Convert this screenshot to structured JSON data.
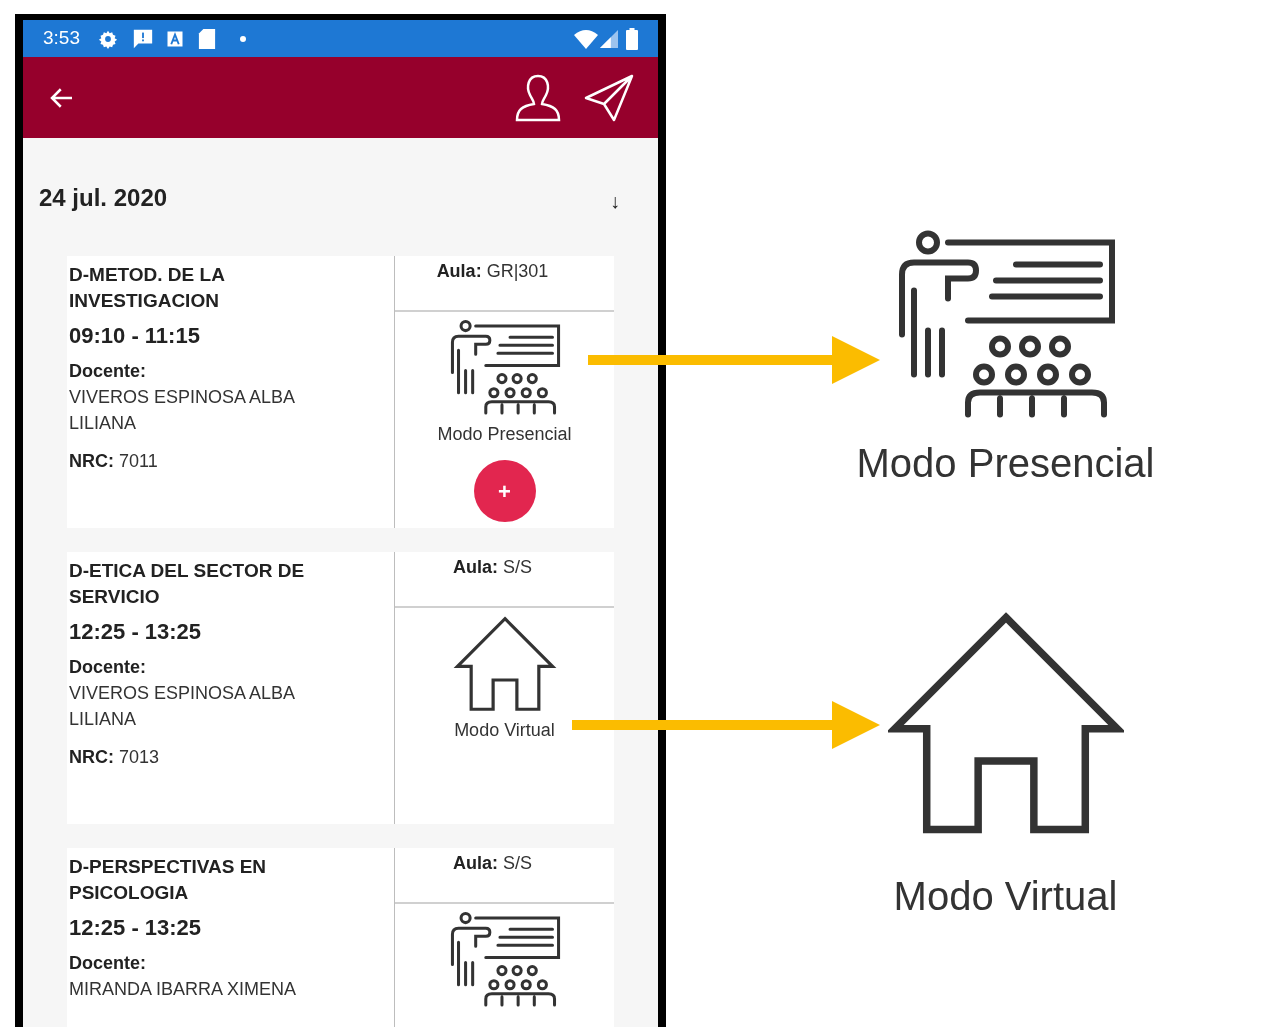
{
  "status_bar": {
    "time": "3:53"
  },
  "date_header": {
    "date": "24 jul. 2020",
    "sort_arrow": "↓"
  },
  "classes": [
    {
      "title": "D-METOD. DE LA INVESTIGACION",
      "time": "09:10 - 11:15",
      "teacher_label": "Docente:",
      "teacher": "VIVEROS ESPINOSA ALBA LILIANA",
      "nrc_label": "NRC:",
      "nrc": "7011",
      "room_label": "Aula:",
      "room": "GR|301",
      "kind": "presencial",
      "mode_label": "Modo Presencial",
      "add_button": "+"
    },
    {
      "title": "D-ETICA DEL SECTOR DE SERVICIO",
      "time": "12:25 - 13:25",
      "teacher_label": "Docente:",
      "teacher": "VIVEROS ESPINOSA ALBA LILIANA",
      "nrc_label": "NRC:",
      "nrc": "7013",
      "room_label": "Aula:",
      "room": "S/S",
      "kind": "virtual",
      "mode_label": "Modo Virtual"
    },
    {
      "title": "D-PERSPECTIVAS EN PSICOLOGIA",
      "time": "12:25 - 13:25",
      "teacher_label": "Docente:",
      "teacher": "MIRANDA IBARRA XIMENA",
      "room_label": "Aula:",
      "room": "S/S",
      "kind": "presencial"
    }
  ],
  "callouts": [
    {
      "kind": "presencial",
      "label": "Modo Presencial"
    },
    {
      "kind": "virtual",
      "label": "Modo Virtual"
    }
  ]
}
